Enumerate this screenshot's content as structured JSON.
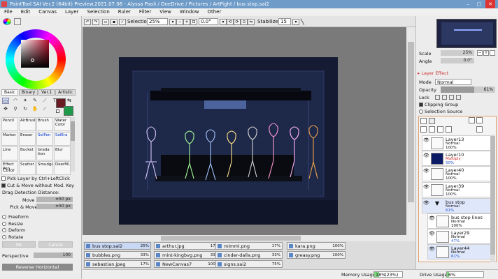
{
  "window": {
    "title": "PaintTool SAI Ver.2 (64bit) Preview.2021.07.06 - Alyssa Paoli / OneDrive / Pictures / ArtFight / bus stop.sai2"
  },
  "menu": [
    "File",
    "Edit",
    "Canvas",
    "Layer",
    "Selection",
    "Ruler",
    "Filter",
    "View",
    "Window",
    "Other"
  ],
  "color": {
    "tabs": [
      "Basic",
      "Binary",
      "Ver.1",
      "Artistic"
    ],
    "primary": "#6b1b24",
    "secondary": "#1e9a4b"
  },
  "brushes": [
    {
      "label": "Pencil",
      "blue": false
    },
    {
      "label": "AirBrush",
      "blue": false
    },
    {
      "label": "Brush",
      "blue": false
    },
    {
      "label": "Water Color",
      "blue": false
    },
    {
      "label": "Marker",
      "blue": false
    },
    {
      "label": "Eraser",
      "blue": false
    },
    {
      "label": "SelPen",
      "blue": true
    },
    {
      "label": "SelEra",
      "blue": true
    },
    {
      "label": "Line",
      "blue": false
    },
    {
      "label": "Bucket",
      "blue": false
    },
    {
      "label": "Grada tion",
      "blue": false
    },
    {
      "label": "Blur",
      "blue": false
    },
    {
      "label": "Effect Pen",
      "blue": false
    },
    {
      "label": "Scatter",
      "blue": false
    },
    {
      "label": "Smudge",
      "blue": false
    },
    {
      "label": "DeerMi...",
      "blue": false
    }
  ],
  "color_label": "Color",
  "options": {
    "pick_layer": "Pick Layer by Ctrl+LeftClick",
    "cut_move": "Cut & Move without Mod. Key",
    "drag_label": "Drag Detection Distance:",
    "move_label": "Move",
    "move_val": "±50 px",
    "pickmove_label": "Pick & Move",
    "pickmove_val": "±50 px",
    "transforms": [
      "Freeform",
      "Resize",
      "Deform",
      "Rotate"
    ],
    "ok": "OK",
    "cancel": "Cancel",
    "perspective_label": "Perspective",
    "perspective_val": "100",
    "reverse": "Reverse Horizontal"
  },
  "toolbar": {
    "selection_label": "Selection",
    "zoom": "25%",
    "angle": "0.0°",
    "stabilizer_label": "Stabilizer",
    "stabilizer": "15"
  },
  "files": [
    {
      "name": "bus stop.sai2",
      "pct": "25%",
      "active": true
    },
    {
      "name": "arthur.jpg",
      "pct": "17%"
    },
    {
      "name": "mimmi.png",
      "pct": "17%"
    },
    {
      "name": "kara.png",
      "pct": "100%"
    },
    {
      "name": "bubbles.png",
      "pct": "33%"
    },
    {
      "name": "mint-kingbvg.png",
      "pct": "33%"
    },
    {
      "name": "cinder-dalla.png",
      "pct": "33%"
    },
    {
      "name": "greasy.png",
      "pct": "100%"
    },
    {
      "name": "sebastian.jpeg",
      "pct": "17%"
    },
    {
      "name": "NewCanvas7",
      "pct": "100%"
    },
    {
      "name": "signs.sai2",
      "pct": "75%"
    }
  ],
  "status": {
    "memory_label": "Memory Usage",
    "memory_val": "18%",
    "memory_extra": "(23%)",
    "drive_label": "Drive Usage",
    "drive_val": "6%",
    "memory_fraction": 0.18,
    "drive_fraction": 0.06
  },
  "nav": {
    "scale_label": "Scale",
    "scale_val": "25%",
    "angle_label": "Angle",
    "angle_val": "0.0°"
  },
  "layer_effect": {
    "title": "Layer Effect",
    "mode_label": "Mode",
    "mode_val": "Normal",
    "opacity_label": "Opacity",
    "opacity_val": "61%",
    "lock_label": "Lock",
    "clipping": "Clipping Group",
    "selsource": "Selection Source"
  },
  "layers": [
    {
      "name": "Layer13",
      "mode": "Normal",
      "op": "100%"
    },
    {
      "name": "Layer10",
      "mode": "Multiply",
      "op": "50%"
    },
    {
      "name": "Layer40",
      "mode": "Normal",
      "op": "100%"
    },
    {
      "name": "Layer39",
      "mode": "Normal",
      "op": "100%"
    },
    {
      "name": "bus stop",
      "mode": "Normal",
      "op": "61%"
    },
    {
      "name": "bus stop lines",
      "mode": "Normal",
      "op": "100%"
    },
    {
      "name": "Layer29",
      "mode": "Normal",
      "op": "47%"
    },
    {
      "name": "Layer44",
      "mode": "Normal",
      "op": "61%"
    }
  ]
}
